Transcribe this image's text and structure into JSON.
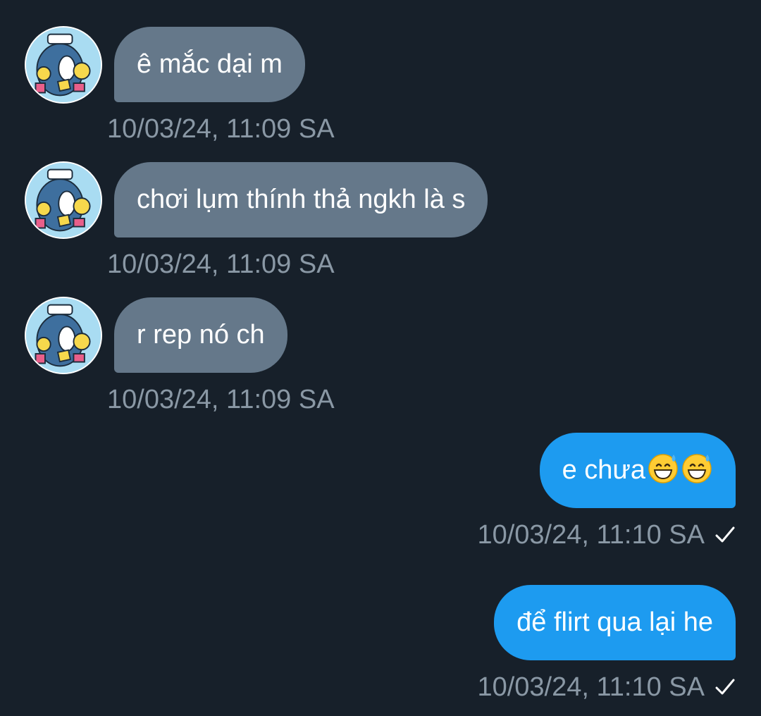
{
  "messages": [
    {
      "direction": "in",
      "text": "ê mắc dại m",
      "time": "10/03/24, 11:09 SA"
    },
    {
      "direction": "in",
      "text": "chơi lụm thính thả ngkh là s",
      "time": "10/03/24, 11:09 SA"
    },
    {
      "direction": "in",
      "text": "r rep nó ch",
      "time": "10/03/24, 11:09 SA"
    },
    {
      "direction": "out",
      "text": "e chưa",
      "emoji": [
        "grinning-sweat-emoji",
        "grinning-sweat-emoji"
      ],
      "time": "10/03/24, 11:10 SA",
      "status_icon": "check-icon"
    },
    {
      "direction": "out",
      "text": "để flirt qua lại he",
      "time": "10/03/24, 11:10 SA",
      "status_icon": "check-icon"
    }
  ],
  "colors": {
    "background": "#17202a",
    "incoming_bubble": "#65788a",
    "outgoing_bubble": "#1d9bf0",
    "timestamp": "#8a98a5"
  }
}
